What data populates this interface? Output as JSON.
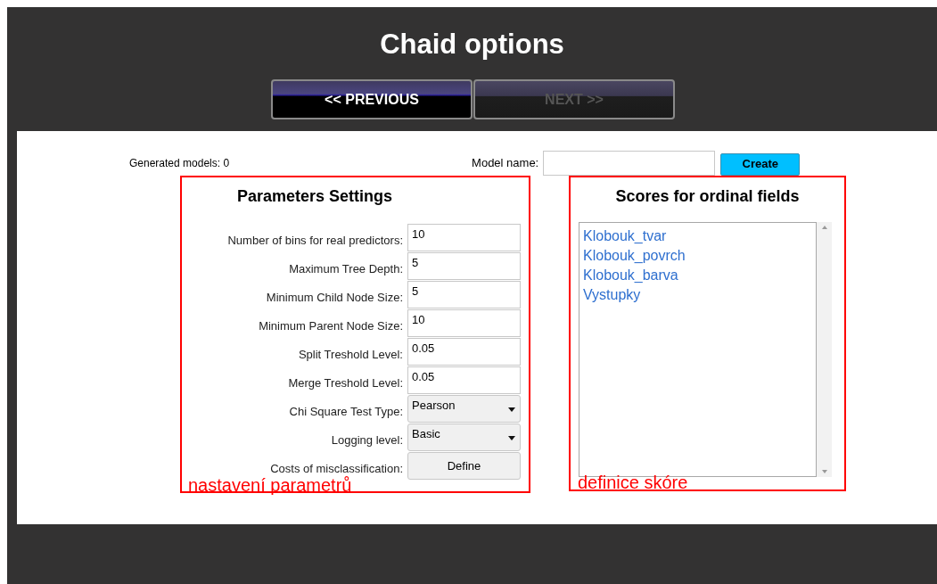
{
  "title": "Chaid options",
  "nav_buttons": [
    {
      "label": "<< PREVIOUS",
      "disabled": false
    },
    {
      "label": "NEXT >>",
      "disabled": true
    }
  ],
  "generated_models": "Generated models: 0",
  "model_name": {
    "label": "Model name:"
  },
  "create_button": "Create",
  "parameters": {
    "title": "Parameters Settings",
    "rows": [
      {
        "kind": "text",
        "label": "Number of bins for real predictors:",
        "value": "10"
      },
      {
        "kind": "text",
        "label": "Maximum Tree Depth:",
        "value": "5"
      },
      {
        "kind": "text",
        "label": "Minimum Child Node Size:",
        "value": "5"
      },
      {
        "kind": "text",
        "label": "Minimum Parent Node Size:",
        "value": "10"
      },
      {
        "kind": "text",
        "label": "Split Treshold Level:",
        "value": "0.05"
      },
      {
        "kind": "text",
        "label": "Merge Treshold Level:",
        "value": "0.05"
      },
      {
        "kind": "select",
        "label": "Chi Square Test Type:",
        "value": "Pearson"
      },
      {
        "kind": "select",
        "label": "Logging level:",
        "value": "Basic"
      },
      {
        "kind": "button",
        "label": "Costs of misclassification:",
        "value": "Define"
      }
    ],
    "annotation": "nastavení parametrů"
  },
  "scores": {
    "title": "Scores for ordinal fields",
    "fields": [
      "Klobouk_tvar",
      "Klobouk_povrch",
      "Klobouk_barva",
      "Vystupky"
    ],
    "annotation": "definice skóre"
  }
}
